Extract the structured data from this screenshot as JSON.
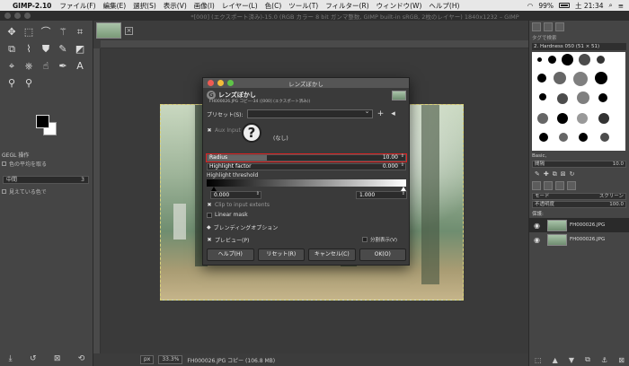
{
  "menubar": {
    "app": "GIMP-2.10",
    "items": [
      "ファイル(F)",
      "編集(E)",
      "選択(S)",
      "表示(V)",
      "画像(I)",
      "レイヤー(L)",
      "色(C)",
      "ツール(T)",
      "フィルター(R)",
      "ウィンドウ(W)",
      "ヘルプ(H)"
    ],
    "battery": "99%",
    "time": "土 21:34"
  },
  "window": {
    "title": "*[000] (エクスポート済み)-15.0 (RGB カラー 8 bit ガンマ整数, GIMP built-in sRGB, 2枚のレイヤー) 1840x1232 – GIMP"
  },
  "toolbox": {
    "options_title": "GEGL 操作",
    "opt_sample_avg": "色の平均を取る",
    "mode_value": "中間",
    "mode_number": "3",
    "opt_visible": "見えている色で"
  },
  "statusbar": {
    "unit": "px",
    "zoom": "33.3%",
    "info": "FH000026.JPG コピー (106.8 MB)"
  },
  "dock": {
    "brush_tab_label": "タグで検索",
    "brush_name": "2. Hardness 050 (51 × 51)",
    "brush_set": "Basic,",
    "spacing_label": "間隔",
    "spacing_value": "10.0",
    "mode_label": "モード",
    "mode_value": "スクリーン",
    "opacity_label": "不透明度",
    "opacity_value": "100.0",
    "lock_label": "保護:",
    "layers": [
      {
        "name": "FH000026.JPG"
      },
      {
        "name": "FH000026.JPG"
      }
    ]
  },
  "dialog": {
    "window_title": "レンズぼかし",
    "heading": "レンズぼかし",
    "subheading": "FH000026.JPG コピー-34 ([000] (エクスポート済み))",
    "preset_label": "プリセット(S):",
    "preset_value": "",
    "aux_label": "Aux Input",
    "aux_value": "(なし)",
    "radius_label": "Radius",
    "radius_value": "10.00",
    "radius_fill": 0.3,
    "highlight_factor_label": "Highlight factor",
    "highlight_factor_value": "0.000",
    "highlight_threshold_label": "Highlight threshold",
    "threshold_min": "0.000",
    "threshold_max": "1.000",
    "clip_label": "Clip to input extents",
    "linear_mask_label": "Linear mask",
    "blending_label": "ブレンディングオプション",
    "preview_label": "プレビュー(P)",
    "split_label": "分割表示(V)",
    "buttons": {
      "help": "ヘルプ(H)",
      "reset": "リセット(R)",
      "cancel": "キャンセル(C)",
      "ok": "OK(O)"
    }
  },
  "colors": {
    "highlight_outline": "#dd2222",
    "selection_marching": "#d8d27a"
  }
}
